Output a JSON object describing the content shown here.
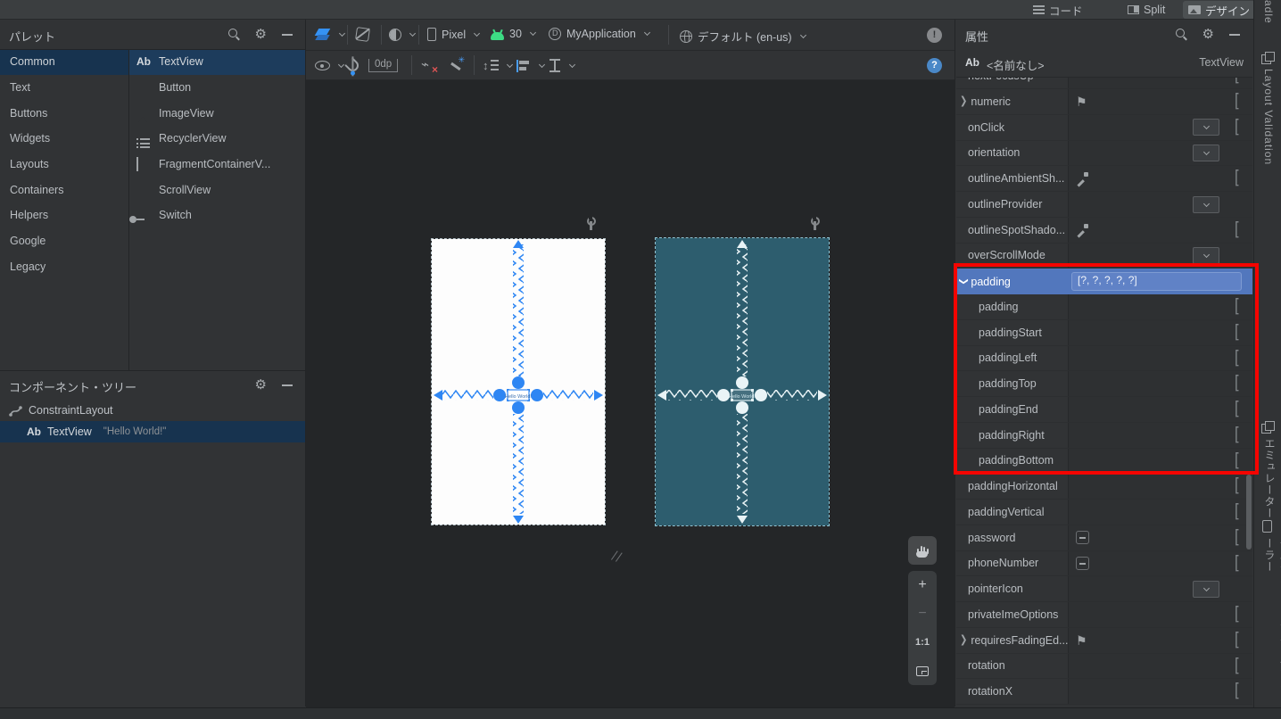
{
  "window": {
    "tabs": {
      "code": "コード",
      "split": "Split",
      "design": "デザイン"
    }
  },
  "palette": {
    "title": "パレット",
    "categories": [
      {
        "label": "Common"
      },
      {
        "label": "Text"
      },
      {
        "label": "Buttons"
      },
      {
        "label": "Widgets"
      },
      {
        "label": "Layouts"
      },
      {
        "label": "Containers"
      },
      {
        "label": "Helpers"
      },
      {
        "label": "Google"
      },
      {
        "label": "Legacy"
      }
    ],
    "items": [
      {
        "label": "TextView"
      },
      {
        "label": "Button"
      },
      {
        "label": "ImageView"
      },
      {
        "label": "RecyclerView"
      },
      {
        "label": "FragmentContainerV..."
      },
      {
        "label": "ScrollView"
      },
      {
        "label": "Switch"
      }
    ]
  },
  "tree": {
    "title": "コンポーネント・ツリー",
    "root": "ConstraintLayout",
    "child": "TextView",
    "child_detail": "\"Hello World!\""
  },
  "toolbar": {
    "device": "Pixel",
    "api": "30",
    "app": "MyApplication",
    "locale": "デフォルト (en-us)",
    "margin": "0dp",
    "error_badge": "!",
    "help_badge": "?"
  },
  "canvas": {
    "widget_text": "Hello World!",
    "zoom_reset": "1:1",
    "zoom_in": "+",
    "zoom_out": "−"
  },
  "attributes": {
    "title": "属性",
    "component_icon": "Ab",
    "component_name": "<名前なし>",
    "component_type": "TextView",
    "clipped_row": "nextFocusUp",
    "padding_value": "[?, ?, ?, ?, ?]",
    "rows": [
      {
        "label": "numeric"
      },
      {
        "label": "onClick"
      },
      {
        "label": "orientation"
      },
      {
        "label": "outlineAmbientSh..."
      },
      {
        "label": "outlineProvider"
      },
      {
        "label": "outlineSpotShado..."
      },
      {
        "label": "overScrollMode"
      },
      {
        "label": "padding"
      },
      {
        "label": "padding"
      },
      {
        "label": "paddingStart"
      },
      {
        "label": "paddingLeft"
      },
      {
        "label": "paddingTop"
      },
      {
        "label": "paddingEnd"
      },
      {
        "label": "paddingRight"
      },
      {
        "label": "paddingBottom"
      },
      {
        "label": "paddingHorizontal"
      },
      {
        "label": "paddingVertical"
      },
      {
        "label": "password"
      },
      {
        "label": "phoneNumber"
      },
      {
        "label": "pointerIcon"
      },
      {
        "label": "privateImeOptions"
      },
      {
        "label": "requiresFadingEd..."
      },
      {
        "label": "rotation"
      },
      {
        "label": "rotationX"
      }
    ]
  },
  "right_strip": {
    "gradle_partial": "adle",
    "layout_validation": "Layout Validation",
    "emulator": "エミュレーター",
    "device_explorer": "デバイス・ファイル・エクスプローラー"
  },
  "colors": {
    "accent_blue": "#3592f3",
    "selection_blue": "#5277bd",
    "blueprint_teal": "#2d5d6e",
    "annotation_red": "#f50400",
    "android_green": "#3ddc84"
  }
}
